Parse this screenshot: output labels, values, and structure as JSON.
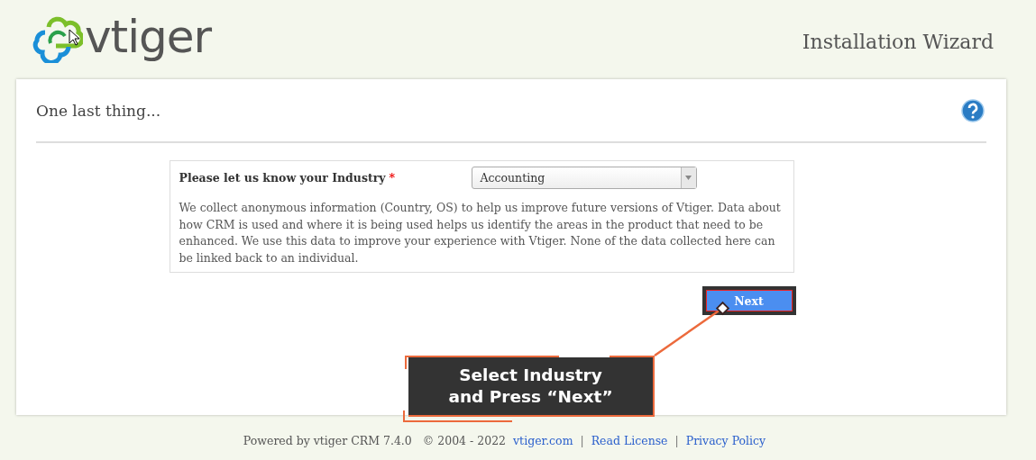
{
  "header": {
    "logo_text": "vtiger",
    "title": "Installation Wizard"
  },
  "card": {
    "heading": "One last thing...",
    "industry": {
      "label": "Please let us know your Industry",
      "required_mark": "*",
      "value": "Accounting"
    },
    "notice": "We collect anonymous information (Country, OS) to help us improve future versions of Vtiger. Data about how CRM is used and where it is being used helps us identify the areas in the product that need to be enhanced. We use this data to improve your experience with Vtiger. None of the data collected here can be linked back to an individual.",
    "next_button": "Next",
    "callout": "Select Industry\nand Press “Next”"
  },
  "footer": {
    "powered": "Powered by vtiger CRM 7.4.0",
    "copyright": "© 2004 - 2022",
    "links": [
      {
        "label": "vtiger.com"
      },
      {
        "label": "Read License"
      },
      {
        "label": "Privacy Policy"
      }
    ],
    "separator": "|"
  }
}
